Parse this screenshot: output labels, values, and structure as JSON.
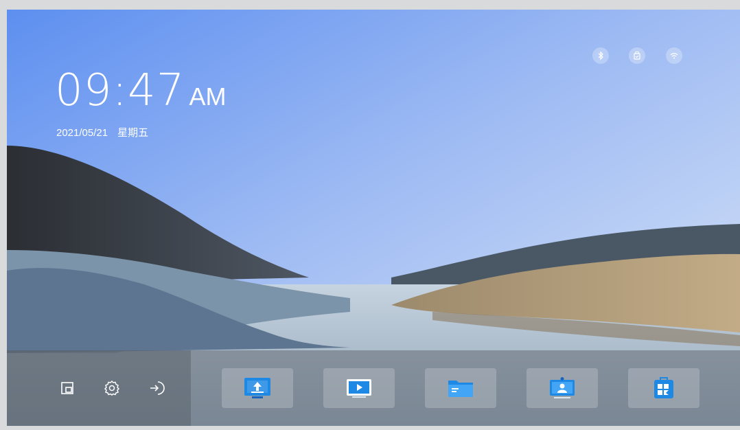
{
  "clock": {
    "time": "09:47",
    "ampm": "AM",
    "date": "2021/05/21",
    "weekday": "星期五"
  },
  "status_icons": [
    "bluetooth-icon",
    "usb-storage-icon",
    "wifi-icon"
  ],
  "dock": {
    "system_buttons": [
      "window-switch-icon",
      "settings-icon",
      "input-source-icon"
    ],
    "apps": [
      "screen-share-app",
      "media-player-app",
      "file-manager-app",
      "video-conference-app",
      "app-store-app"
    ]
  },
  "colors": {
    "accent_blue": "#1e88e5",
    "sky_top": "#6f9ef0",
    "dock_bg": "#6e7680"
  }
}
